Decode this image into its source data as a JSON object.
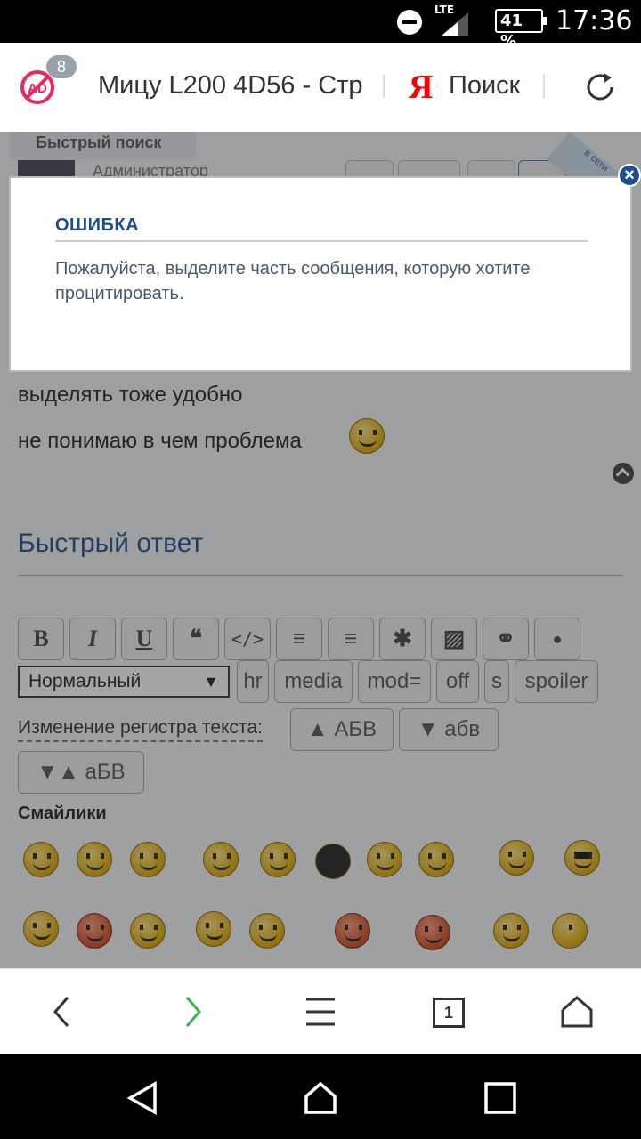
{
  "status_bar": {
    "network": "LTE",
    "battery": "41 %",
    "time": "17:36"
  },
  "browser": {
    "ad_block_count": "8",
    "tab_title": "Мицу L200 4D56 - Стр",
    "search_logo": "Я",
    "search_label": "Поиск",
    "tabs_count": "1"
  },
  "page": {
    "quick_search_tab": "Быстрый поиск",
    "post_author_role": "Администратор",
    "ribbon_text": "в сети",
    "post_lines": [
      "выделять тоже удобно",
      "не понимаю в чем проблема"
    ],
    "quick_reply_title": "Быстрый ответ",
    "toolbar": {
      "format_buttons": [
        "B",
        "I",
        "U",
        "❝",
        "</>",
        "≡",
        "≡",
        "✱",
        "▨",
        "⚭",
        "●"
      ],
      "select_value": "Нормальный",
      "select_arrow": "▼",
      "tags": [
        "hr",
        "media",
        "mod=",
        "off",
        "s",
        "spoiler"
      ],
      "case_label": "Изменение регистра текста:",
      "case_buttons": [
        "▲ АБВ",
        "▼ абв",
        "▼▲ аБВ"
      ]
    },
    "smileys_title": "Смайлики"
  },
  "modal": {
    "title": "ОШИБКА",
    "message": "Пожалуйста, выделите часть сообщения, которую хотите процитировать.",
    "close": "×"
  }
}
